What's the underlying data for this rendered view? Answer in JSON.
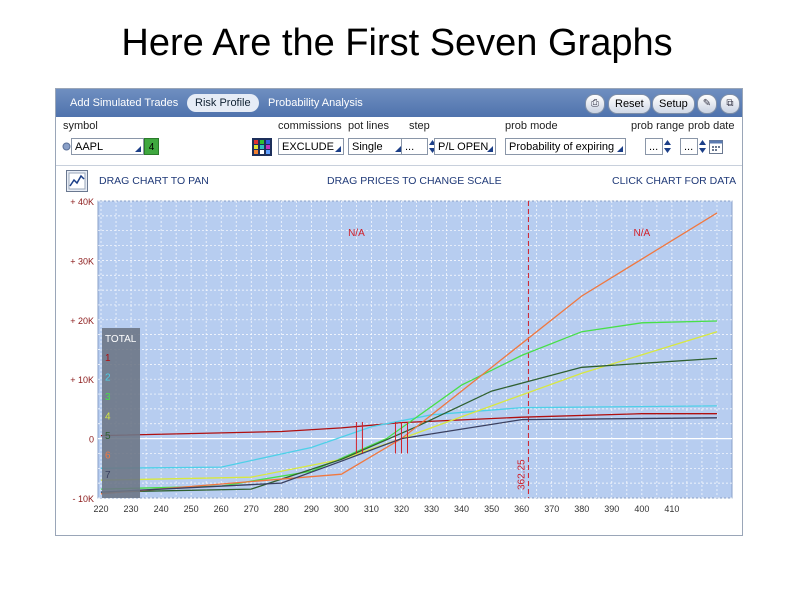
{
  "slide": {
    "title": "Here Are the First Seven Graphs"
  },
  "tabs": [
    {
      "label": "Add Simulated Trades"
    },
    {
      "label": "Risk Profile"
    },
    {
      "label": "Probability Analysis"
    }
  ],
  "tab_buttons": {
    "reset": "Reset",
    "setup": "Setup"
  },
  "icons": [
    "print-icon",
    "pin-icon",
    "detach-icon",
    "chart-icon",
    "color-grid-icon",
    "calendar-icon"
  ],
  "toolbar": {
    "labels": {
      "symbol": "symbol",
      "commissions": "commissions",
      "pot_lines": "pot lines",
      "step": "step",
      "prob_mode": "prob mode",
      "prob_range": "prob range",
      "prob_date": "prob date"
    },
    "symbol_value": "AAPL",
    "symbol_badge": "4",
    "commissions_value": "EXCLUDE",
    "pot_lines_value": "Single",
    "step_value": "...",
    "pl_value": "P/L OPEN",
    "prob_mode_value": "Probability of expiring",
    "prob_range_value": "...",
    "prob_date_value": "..."
  },
  "hints": {
    "pan": "DRAG CHART TO PAN",
    "scale": "DRAG PRICES TO CHANGE SCALE",
    "data": "CLICK CHART FOR DATA"
  },
  "colors": {
    "plot_bg": "#b7cdf0",
    "grid": "#ffffff",
    "axis_text": "#8b1a1a",
    "marker": "#d0202a"
  },
  "chart_data": {
    "type": "line",
    "xlabel": "",
    "ylabel": "",
    "x_ticks": [
      "220",
      "230",
      "240",
      "250",
      "260",
      "270",
      "280",
      "290",
      "300",
      "310",
      "320",
      "330",
      "340",
      "350",
      "360",
      "370",
      "380",
      "390",
      "400",
      "410"
    ],
    "y_ticks": [
      "+ 40K",
      "+ 30K",
      "+ 20K",
      "+ 10K",
      "0",
      "- 10K"
    ],
    "xlim": [
      219,
      430
    ],
    "ylim": [
      -10000,
      40000
    ],
    "grid": true,
    "annotations": [
      "N/A",
      "N/A",
      "362.25"
    ],
    "vertical_marker_x": 362.25,
    "legend": {
      "title": "TOTAL",
      "position": "left",
      "entries": [
        "1",
        "2",
        "3",
        "4",
        "5",
        "6",
        "7"
      ]
    },
    "series": [
      {
        "values": [
          [
            220,
            500
          ],
          [
            280,
            1200
          ],
          [
            300,
            1800
          ],
          [
            320,
            2700
          ],
          [
            360,
            3600
          ],
          [
            400,
            4200
          ],
          [
            425,
            4200
          ]
        ],
        "color": "#b01010"
      },
      {
        "values": [
          [
            220,
            -5000
          ],
          [
            260,
            -4800
          ],
          [
            290,
            -1500
          ],
          [
            310,
            2000
          ],
          [
            330,
            4000
          ],
          [
            360,
            5200
          ],
          [
            425,
            5500
          ]
        ],
        "color": "#4ed0e8"
      },
      {
        "values": [
          [
            220,
            -8500
          ],
          [
            260,
            -8000
          ],
          [
            290,
            -5500
          ],
          [
            315,
            0
          ],
          [
            340,
            9000
          ],
          [
            360,
            14000
          ],
          [
            380,
            18000
          ],
          [
            400,
            19500
          ],
          [
            425,
            19800
          ]
        ],
        "color": "#48e048"
      },
      {
        "values": [
          [
            220,
            -7000
          ],
          [
            270,
            -6500
          ],
          [
            300,
            -3500
          ],
          [
            320,
            0
          ],
          [
            350,
            5500
          ],
          [
            380,
            11000
          ],
          [
            425,
            18000
          ]
        ],
        "color": "#d8e840"
      },
      {
        "values": [
          [
            220,
            -9000
          ],
          [
            270,
            -8500
          ],
          [
            300,
            -3500
          ],
          [
            325,
            2000
          ],
          [
            350,
            8000
          ],
          [
            380,
            12000
          ],
          [
            425,
            13500
          ]
        ],
        "color": "#2f6030"
      },
      {
        "values": [
          [
            220,
            -9300
          ],
          [
            300,
            -6000
          ],
          [
            320,
            0
          ],
          [
            345,
            10000
          ],
          [
            380,
            24000
          ],
          [
            425,
            38000
          ]
        ],
        "color": "#f07840"
      },
      {
        "values": [
          [
            220,
            -9000
          ],
          [
            280,
            -7500
          ],
          [
            300,
            -3800
          ],
          [
            320,
            0
          ],
          [
            360,
            3200
          ],
          [
            425,
            3500
          ]
        ],
        "color": "#3a4060"
      }
    ]
  }
}
